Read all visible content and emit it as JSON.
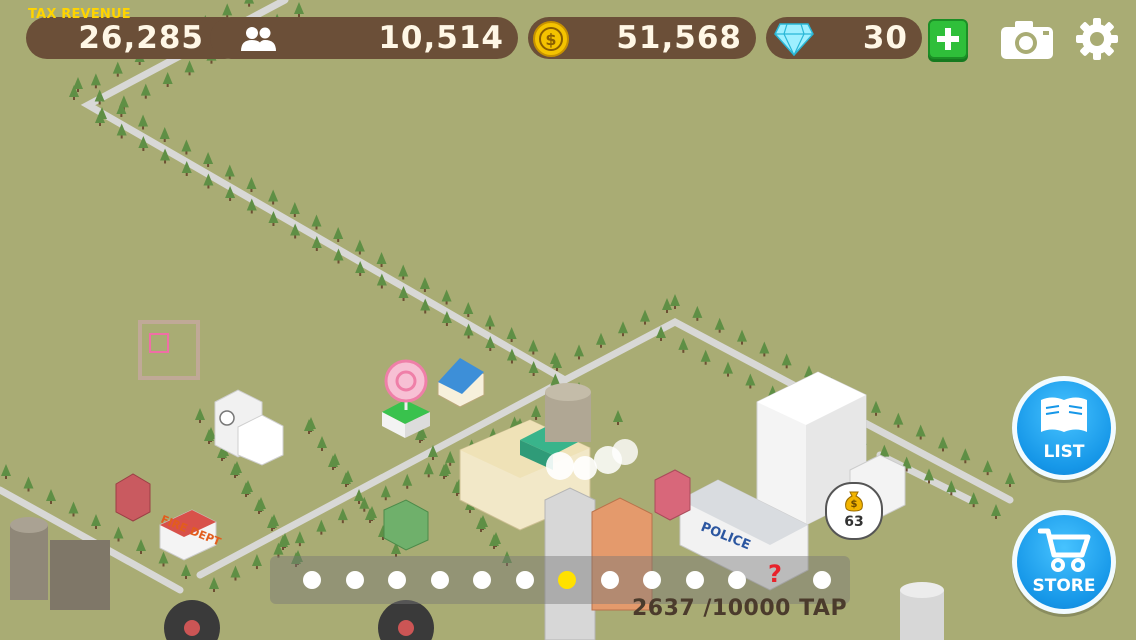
{
  "hud": {
    "tax_label": "TAX REVENUE",
    "tax_value": "26,285",
    "population_icon": "people-icon",
    "population_value": "10,514",
    "coin_icon": "coin-icon",
    "coins_value": "51,568",
    "gem_icon": "diamond-icon",
    "gems_value": "30",
    "add_icon": "plus-icon",
    "camera_icon": "camera-icon",
    "settings_icon": "gear-icon"
  },
  "buttons": {
    "list_label": "LIST",
    "list_icon": "book-icon",
    "store_label": "STORE",
    "store_icon": "cart-icon"
  },
  "pager": {
    "dot_count": 13,
    "active_index": 6,
    "question_mark": "?"
  },
  "tap_counter": "2637 /10000 TAP",
  "income_bubble": "63",
  "building_signs": {
    "police": "POLICE",
    "fire_dept": "FIRE DEPT"
  },
  "colors": {
    "ground": "#a9ac74",
    "hud_pill": "#6b4f38",
    "tax_label": "#ffd400",
    "accent_blue": "#1697e8",
    "plus_green": "#2fbf3a",
    "active_dot": "#ffe100"
  }
}
